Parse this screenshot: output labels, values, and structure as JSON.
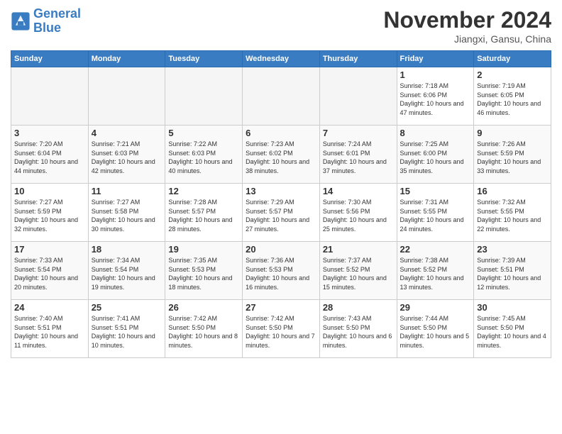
{
  "header": {
    "logo_line1": "General",
    "logo_line2": "Blue",
    "month_title": "November 2024",
    "location": "Jiangxi, Gansu, China"
  },
  "weekdays": [
    "Sunday",
    "Monday",
    "Tuesday",
    "Wednesday",
    "Thursday",
    "Friday",
    "Saturday"
  ],
  "weeks": [
    [
      {
        "day": "",
        "empty": true
      },
      {
        "day": "",
        "empty": true
      },
      {
        "day": "",
        "empty": true
      },
      {
        "day": "",
        "empty": true
      },
      {
        "day": "",
        "empty": true
      },
      {
        "day": "1",
        "sunrise": "7:18 AM",
        "sunset": "6:06 PM",
        "daylight": "10 hours and 47 minutes."
      },
      {
        "day": "2",
        "sunrise": "7:19 AM",
        "sunset": "6:05 PM",
        "daylight": "10 hours and 46 minutes."
      }
    ],
    [
      {
        "day": "3",
        "sunrise": "7:20 AM",
        "sunset": "6:04 PM",
        "daylight": "10 hours and 44 minutes."
      },
      {
        "day": "4",
        "sunrise": "7:21 AM",
        "sunset": "6:03 PM",
        "daylight": "10 hours and 42 minutes."
      },
      {
        "day": "5",
        "sunrise": "7:22 AM",
        "sunset": "6:03 PM",
        "daylight": "10 hours and 40 minutes."
      },
      {
        "day": "6",
        "sunrise": "7:23 AM",
        "sunset": "6:02 PM",
        "daylight": "10 hours and 38 minutes."
      },
      {
        "day": "7",
        "sunrise": "7:24 AM",
        "sunset": "6:01 PM",
        "daylight": "10 hours and 37 minutes."
      },
      {
        "day": "8",
        "sunrise": "7:25 AM",
        "sunset": "6:00 PM",
        "daylight": "10 hours and 35 minutes."
      },
      {
        "day": "9",
        "sunrise": "7:26 AM",
        "sunset": "5:59 PM",
        "daylight": "10 hours and 33 minutes."
      }
    ],
    [
      {
        "day": "10",
        "sunrise": "7:27 AM",
        "sunset": "5:59 PM",
        "daylight": "10 hours and 32 minutes."
      },
      {
        "day": "11",
        "sunrise": "7:27 AM",
        "sunset": "5:58 PM",
        "daylight": "10 hours and 30 minutes."
      },
      {
        "day": "12",
        "sunrise": "7:28 AM",
        "sunset": "5:57 PM",
        "daylight": "10 hours and 28 minutes."
      },
      {
        "day": "13",
        "sunrise": "7:29 AM",
        "sunset": "5:57 PM",
        "daylight": "10 hours and 27 minutes."
      },
      {
        "day": "14",
        "sunrise": "7:30 AM",
        "sunset": "5:56 PM",
        "daylight": "10 hours and 25 minutes."
      },
      {
        "day": "15",
        "sunrise": "7:31 AM",
        "sunset": "5:55 PM",
        "daylight": "10 hours and 24 minutes."
      },
      {
        "day": "16",
        "sunrise": "7:32 AM",
        "sunset": "5:55 PM",
        "daylight": "10 hours and 22 minutes."
      }
    ],
    [
      {
        "day": "17",
        "sunrise": "7:33 AM",
        "sunset": "5:54 PM",
        "daylight": "10 hours and 20 minutes."
      },
      {
        "day": "18",
        "sunrise": "7:34 AM",
        "sunset": "5:54 PM",
        "daylight": "10 hours and 19 minutes."
      },
      {
        "day": "19",
        "sunrise": "7:35 AM",
        "sunset": "5:53 PM",
        "daylight": "10 hours and 18 minutes."
      },
      {
        "day": "20",
        "sunrise": "7:36 AM",
        "sunset": "5:53 PM",
        "daylight": "10 hours and 16 minutes."
      },
      {
        "day": "21",
        "sunrise": "7:37 AM",
        "sunset": "5:52 PM",
        "daylight": "10 hours and 15 minutes."
      },
      {
        "day": "22",
        "sunrise": "7:38 AM",
        "sunset": "5:52 PM",
        "daylight": "10 hours and 13 minutes."
      },
      {
        "day": "23",
        "sunrise": "7:39 AM",
        "sunset": "5:51 PM",
        "daylight": "10 hours and 12 minutes."
      }
    ],
    [
      {
        "day": "24",
        "sunrise": "7:40 AM",
        "sunset": "5:51 PM",
        "daylight": "10 hours and 11 minutes."
      },
      {
        "day": "25",
        "sunrise": "7:41 AM",
        "sunset": "5:51 PM",
        "daylight": "10 hours and 10 minutes."
      },
      {
        "day": "26",
        "sunrise": "7:42 AM",
        "sunset": "5:50 PM",
        "daylight": "10 hours and 8 minutes."
      },
      {
        "day": "27",
        "sunrise": "7:42 AM",
        "sunset": "5:50 PM",
        "daylight": "10 hours and 7 minutes."
      },
      {
        "day": "28",
        "sunrise": "7:43 AM",
        "sunset": "5:50 PM",
        "daylight": "10 hours and 6 minutes."
      },
      {
        "day": "29",
        "sunrise": "7:44 AM",
        "sunset": "5:50 PM",
        "daylight": "10 hours and 5 minutes."
      },
      {
        "day": "30",
        "sunrise": "7:45 AM",
        "sunset": "5:50 PM",
        "daylight": "10 hours and 4 minutes."
      }
    ]
  ]
}
